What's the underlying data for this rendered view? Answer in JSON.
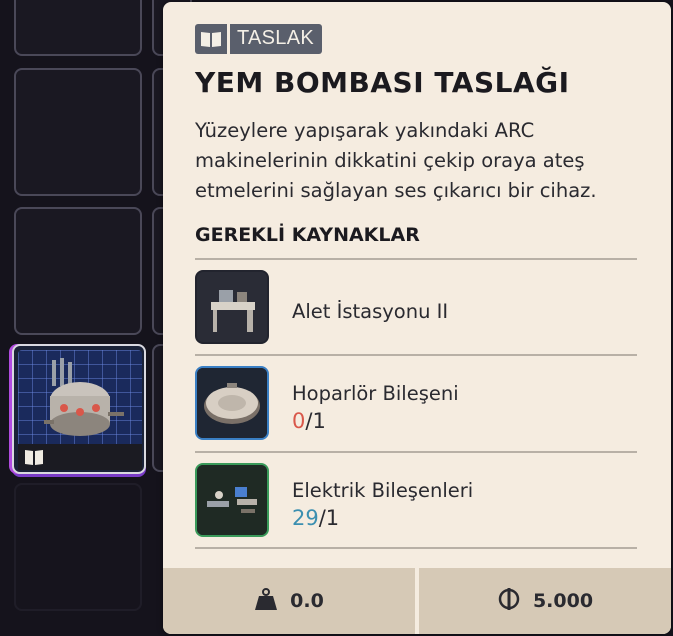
{
  "item": {
    "tag_label": "TASLAK",
    "title": "YEM BOMBASI TASLAĞI",
    "description": "Yüzeylere yapışarak yakındaki ARC makinelerinin dikkatini çekip oraya ateş etmelerini sağlayan ses çıkarıcı bir cihaz.",
    "requirements_title": "GEREKLİ KAYNAKLAR",
    "resources": [
      {
        "name": "Alet İstasyonu II",
        "icon": "workbench-icon",
        "border_color": "#22242e"
      },
      {
        "name": "Hoparlör Bileşeni",
        "have": "0",
        "need": "/1",
        "have_color": "#d9574a",
        "icon": "speaker-component-icon",
        "border_color": "#3a7fc4"
      },
      {
        "name": "Elektrik Bileşenleri",
        "have": "29",
        "need": "/1",
        "have_color": "#3b8fb0",
        "icon": "electric-components-icon",
        "border_color": "#3a9a5a"
      }
    ],
    "weight": "0.0",
    "price": "5.000",
    "weight_icon": "weight-icon",
    "price_icon": "coin-icon"
  },
  "inventory": {
    "featured_item_icon": "decoy-bomb-icon",
    "featured_badge_icon": "book-icon"
  },
  "colors": {
    "panel_bg": "#f5ece0",
    "footer_bg": "#d6c9b6",
    "tag_bg": "#5a5f6c",
    "shortage": "#d9574a",
    "sufficient": "#3b8fb0"
  }
}
